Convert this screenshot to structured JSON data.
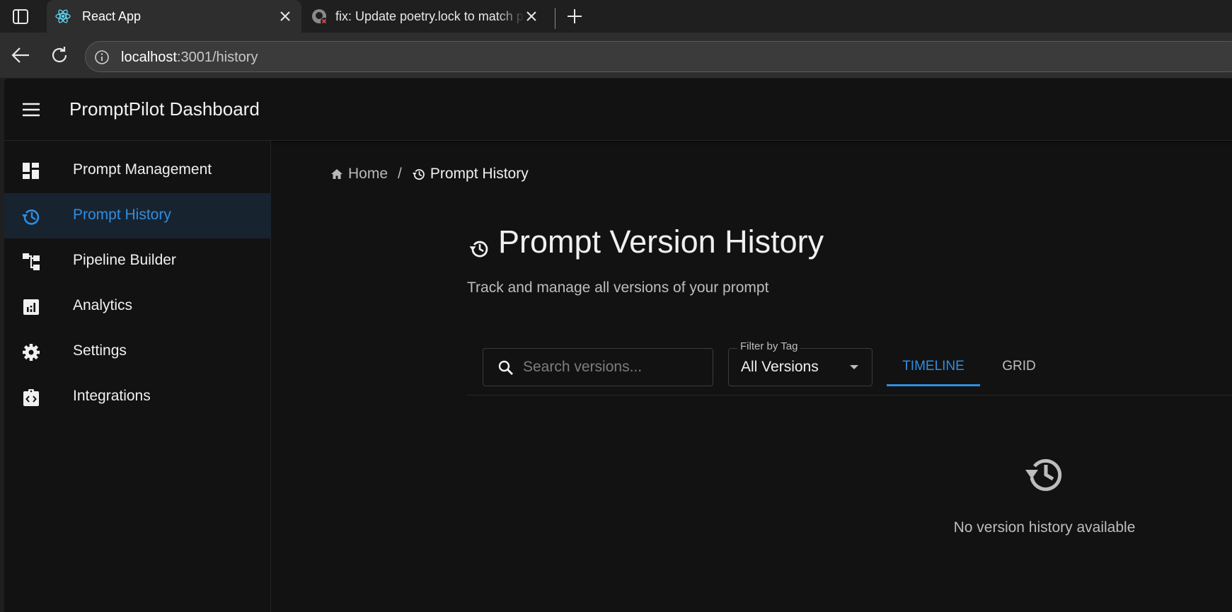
{
  "browser": {
    "tabs": [
      {
        "title": "React App",
        "favicon": "react-icon",
        "active": true
      },
      {
        "title": "fix: Update poetry.lock to match p",
        "favicon": "github-icon",
        "active": false
      }
    ],
    "url": {
      "host": "localhost",
      "rest": ":3001/history"
    }
  },
  "app": {
    "title": "PromptPilot Dashboard",
    "accent_color": "#2f8ee0",
    "sidebar": {
      "items": [
        {
          "label": "Prompt Management",
          "icon": "dashboard-icon",
          "active": false
        },
        {
          "label": "Prompt History",
          "icon": "history-icon",
          "active": true
        },
        {
          "label": "Pipeline Builder",
          "icon": "account-tree-icon",
          "active": false
        },
        {
          "label": "Analytics",
          "icon": "analytics-icon",
          "active": false
        },
        {
          "label": "Settings",
          "icon": "gear-icon",
          "active": false
        },
        {
          "label": "Integrations",
          "icon": "integration-icon",
          "active": false
        }
      ]
    },
    "breadcrumb": {
      "home": "Home",
      "separator": "/",
      "current": "Prompt History"
    },
    "page": {
      "title": "Prompt Version History",
      "subtitle": "Track and manage all versions of your prompt"
    },
    "toolbar": {
      "search_placeholder": "Search versions...",
      "filter_label": "Filter by Tag",
      "filter_value": "All Versions",
      "view_tabs": [
        {
          "label": "TIMELINE",
          "active": true
        },
        {
          "label": "GRID",
          "active": false
        }
      ]
    },
    "empty_state": {
      "message": "No version history available"
    }
  }
}
